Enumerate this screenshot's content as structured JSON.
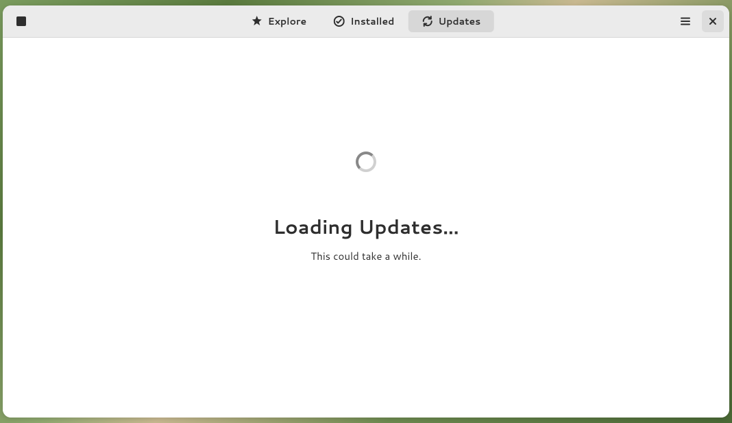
{
  "header": {
    "tabs": [
      {
        "label": "Explore",
        "active": false
      },
      {
        "label": "Installed",
        "active": false
      },
      {
        "label": "Updates",
        "active": true
      }
    ]
  },
  "content": {
    "title": "Loading Updates…",
    "subtitle": "This could take a while."
  }
}
